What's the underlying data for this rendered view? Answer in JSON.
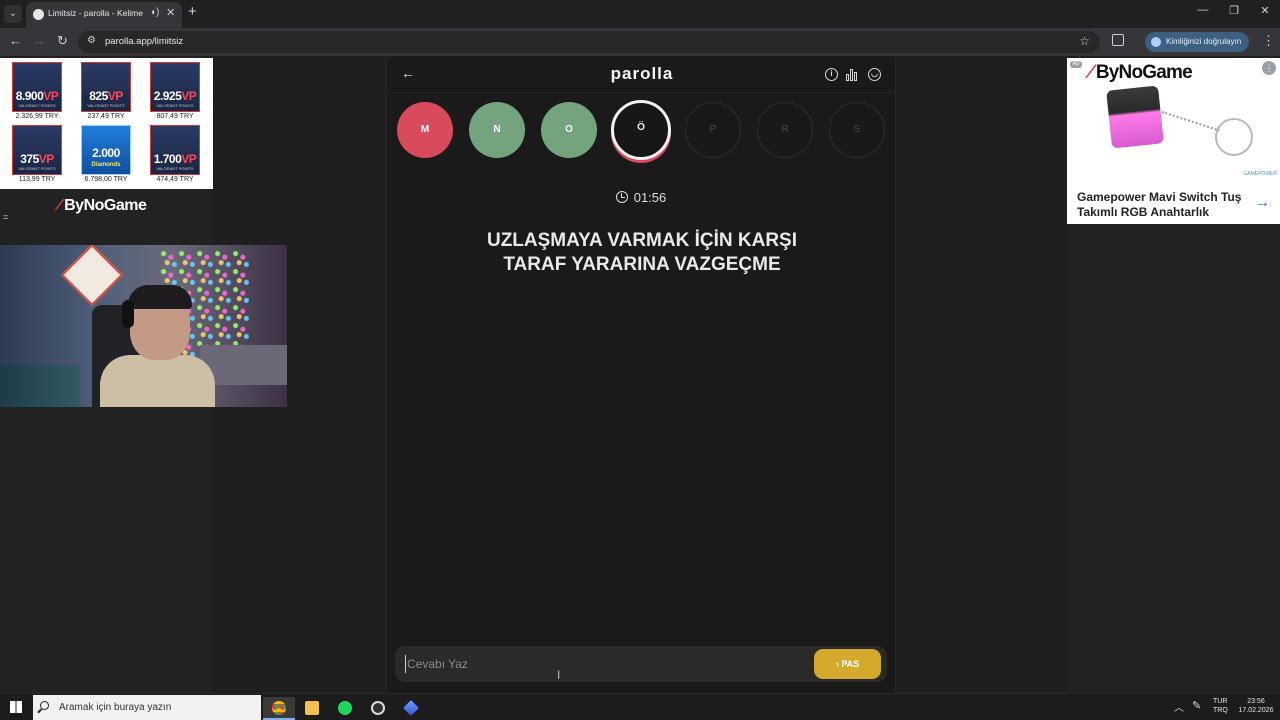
{
  "browser": {
    "tab_title": "Limitsiz - parolla - Kelime o",
    "url": "parolla.app/limitsiz",
    "profile_chip": "Kimliğinizi doğrulayın"
  },
  "stream_overlay": {
    "products": [
      {
        "amount": "8.900",
        "unit": "VP",
        "sub": "VALORANT POINTS",
        "price": "2.326,99 TRY"
      },
      {
        "amount": "825",
        "unit": "VP",
        "sub": "VALORANT POINTS",
        "price": "237,49 TRY"
      },
      {
        "amount": "2.925",
        "unit": "VP",
        "sub": "VALORANT POINTS",
        "price": "807,49 TRY"
      },
      {
        "amount": "375",
        "unit": "VP",
        "sub": "VALORANT POINTS",
        "price": "113,99 TRY"
      },
      {
        "amount": "2.000",
        "unit": "",
        "sub": "Diamonds",
        "price": "6.798,00 TRY"
      },
      {
        "amount": "1.700",
        "unit": "VP",
        "sub": "VALORANT POINTS",
        "price": "474,49 TRY"
      }
    ],
    "logo": "ByNoGame",
    "eq_mark": "="
  },
  "game": {
    "brand": "parolla",
    "letters": [
      {
        "char": "M",
        "state": "wrong"
      },
      {
        "char": "N",
        "state": "correct"
      },
      {
        "char": "O",
        "state": "correct"
      },
      {
        "char": "Ö",
        "state": "active"
      },
      {
        "char": "P",
        "state": "pending"
      },
      {
        "char": "R",
        "state": "pending"
      },
      {
        "char": "S",
        "state": "pending"
      }
    ],
    "timer": "01:56",
    "question_line1": "UZLAŞMAYA VARMAK İÇİN KARŞI",
    "question_line2": "TARAF YARARINA VAZGEÇME",
    "answer_placeholder": "Cevabı Yaz",
    "pass_label": "PAS",
    "colors": {
      "wrong": "#d94a5c",
      "correct": "#74a47d",
      "pass": "#d5a92b"
    }
  },
  "ad": {
    "badge": "AD",
    "brand": "ByNoGame",
    "tiny_brand": "GAMEPOWER",
    "title": "Gamepower Mavi Switch Tuş Takımlı RGB Anahtarlık"
  },
  "taskbar": {
    "search_placeholder": "Aramak için buraya yazın",
    "lang_line1": "TUR",
    "lang_line2": "TRQ",
    "time": "23:56",
    "date": "17.02.2026"
  }
}
